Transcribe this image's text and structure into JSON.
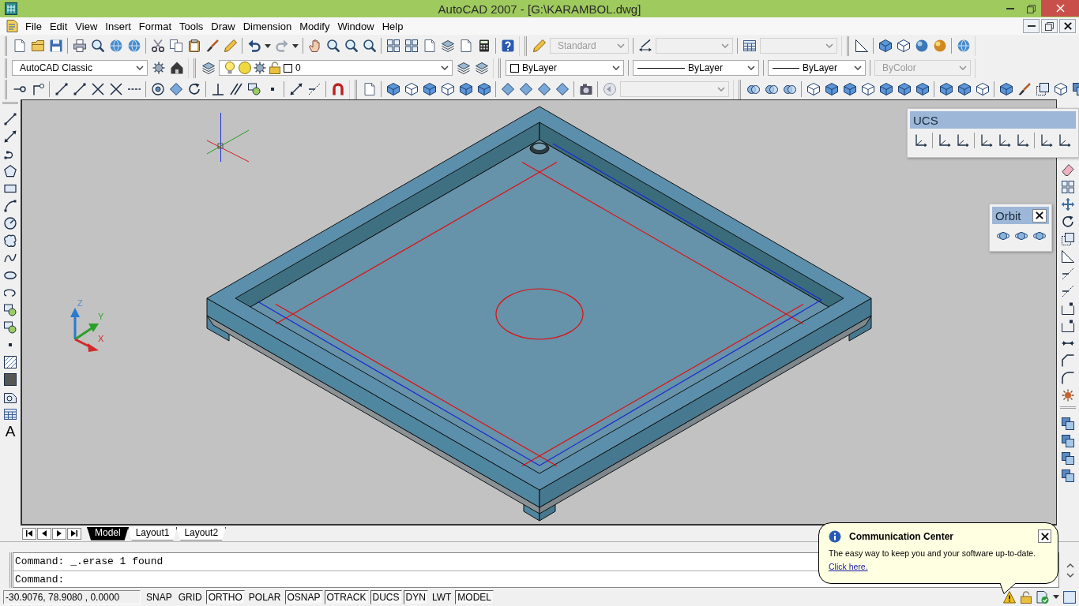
{
  "window": {
    "title": "AutoCAD 2007 - [G:\\KARAMBOL.dwg]"
  },
  "menu_bar": {
    "items": [
      "File",
      "Edit",
      "View",
      "Insert",
      "Format",
      "Tools",
      "Draw",
      "Dimension",
      "Modify",
      "Window",
      "Help"
    ]
  },
  "toolbar_rows": [
    {
      "dropdowns": [
        {
          "kind": "plain",
          "value": "Standard",
          "disabled": true
        },
        {
          "kind": "plain",
          "disabled": true
        },
        {
          "kind": "plain",
          "disabled": true
        }
      ]
    },
    {
      "dropdowns": [
        {
          "kind": "plain",
          "value": "AutoCAD Classic",
          "disabled": false
        },
        {
          "kind": "layer",
          "value": "0",
          "disabled": false
        },
        {
          "kind": "color",
          "value": "ByLayer",
          "disabled": false
        },
        {
          "kind": "linetype",
          "value": "ByLayer",
          "disabled": false
        },
        {
          "kind": "lineweight",
          "value": "ByLayer",
          "disabled": false
        },
        {
          "kind": "plain",
          "value": "ByColor",
          "disabled": true
        }
      ]
    },
    {
      "dropdowns": [
        {
          "kind": "plain",
          "disabled": true
        }
      ]
    }
  ],
  "draw_toolbar": {
    "text_tool": "A"
  },
  "ucs_icon": {
    "labels": [
      "Z",
      "Y",
      "X"
    ]
  },
  "floating_toolbars": [
    {
      "kind": "ucs",
      "title": "UCS",
      "closable": false
    },
    {
      "kind": "orbit",
      "title": "Orbit",
      "closable": true
    }
  ],
  "layout_tabs": [
    {
      "label": "Model",
      "selected": true
    },
    {
      "label": "Layout1",
      "selected": false
    },
    {
      "label": "Layout2",
      "selected": false
    }
  ],
  "command_line": {
    "history": [
      "Command: _.erase 1 found"
    ],
    "prompt": "Command:"
  },
  "status_bar": {
    "coordinates": "-30.9076, 78.9080 , 0.0000",
    "toggles": [
      {
        "label": "SNAP",
        "on": false
      },
      {
        "label": "GRID",
        "on": false
      },
      {
        "label": "ORTHO",
        "on": true
      },
      {
        "label": "POLAR",
        "on": false
      },
      {
        "label": "OSNAP",
        "on": true
      },
      {
        "label": "OTRACK",
        "on": true
      },
      {
        "label": "DUCS",
        "on": true
      },
      {
        "label": "DYN",
        "on": true
      },
      {
        "label": "LWT",
        "on": false
      },
      {
        "label": "MODEL",
        "on": true
      }
    ]
  },
  "notification": {
    "title": "Communication Center",
    "message": "The easy way to keep you and your software up-to-date.",
    "link": "Click here."
  }
}
